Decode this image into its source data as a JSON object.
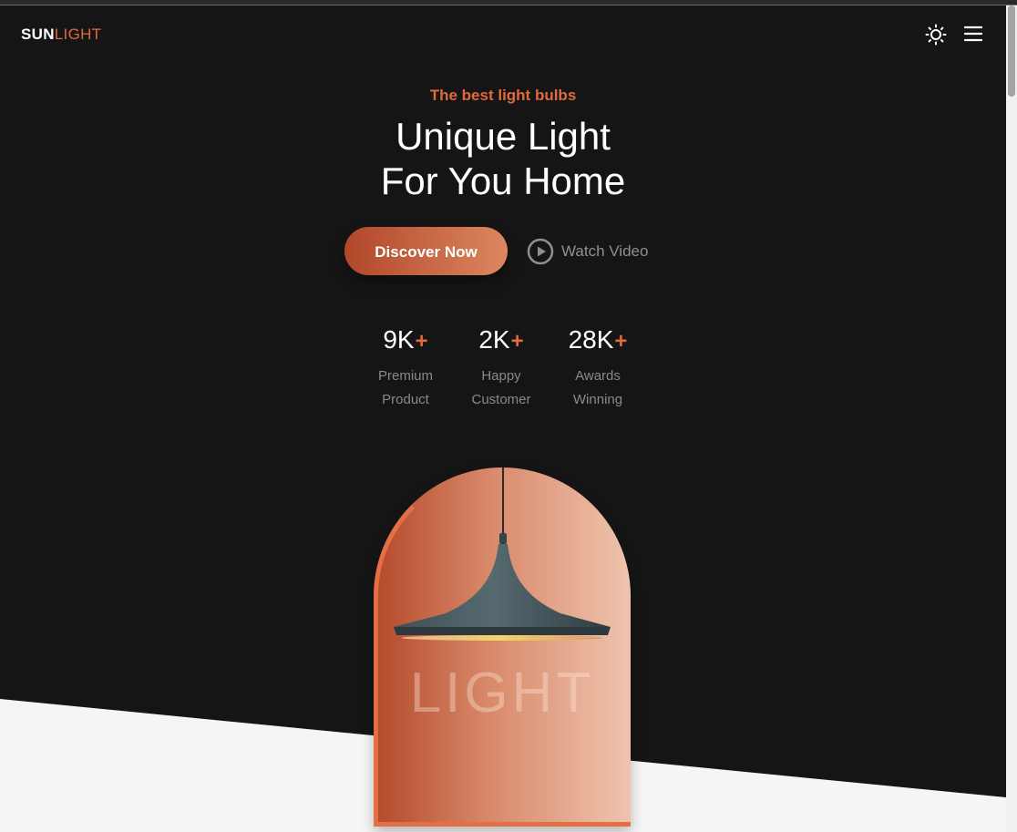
{
  "brand": {
    "name_part1": "SUN",
    "name_part2": "LIGHT",
    "accent_color": "#e06a3b"
  },
  "header": {
    "theme_icon": "sun-icon",
    "menu_icon": "hamburger-menu-icon"
  },
  "hero": {
    "subtitle": "The best light bulbs",
    "title_line1": "Unique Light",
    "title_line2": "For You Home",
    "primary_button": "Discover Now",
    "secondary_button": "Watch Video",
    "secondary_icon": "play-circle-icon"
  },
  "stats": [
    {
      "value": "9K",
      "suffix": "+",
      "label_line1": "Premium",
      "label_line2": "Product"
    },
    {
      "value": "2K",
      "suffix": "+",
      "label_line1": "Happy",
      "label_line2": "Customer"
    },
    {
      "value": "28K",
      "suffix": "+",
      "label_line1": "Awards",
      "label_line2": "Winning"
    }
  ],
  "showcase": {
    "word": "LIGHT",
    "image": "pendant-lamp"
  },
  "colors": {
    "background": "#151515",
    "lower_section": "#f5f5f5",
    "button_gradient_start": "#b1472a",
    "button_gradient_end": "#dc875f"
  }
}
